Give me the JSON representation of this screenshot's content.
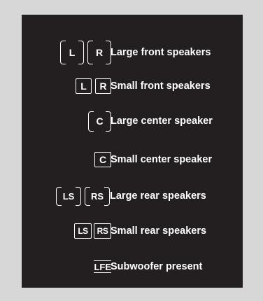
{
  "rows": [
    {
      "label": "Large front speakers",
      "icons": [
        "L",
        "R"
      ]
    },
    {
      "label": "Small front speakers",
      "icons": [
        "L",
        "R"
      ]
    },
    {
      "label": "Large center speaker",
      "icons": [
        "C"
      ]
    },
    {
      "label": "Small center speaker",
      "icons": [
        "C"
      ]
    },
    {
      "label": "Large rear speakers",
      "icons": [
        "LS",
        "RS"
      ]
    },
    {
      "label": "Small rear speakers",
      "icons": [
        "LS",
        "RS"
      ]
    },
    {
      "label": "Subwoofer present",
      "icons": [
        "LFE"
      ]
    }
  ],
  "colors": {
    "background": "#d7d7d7",
    "panel": "#231f20",
    "foreground": "#ffffff"
  }
}
